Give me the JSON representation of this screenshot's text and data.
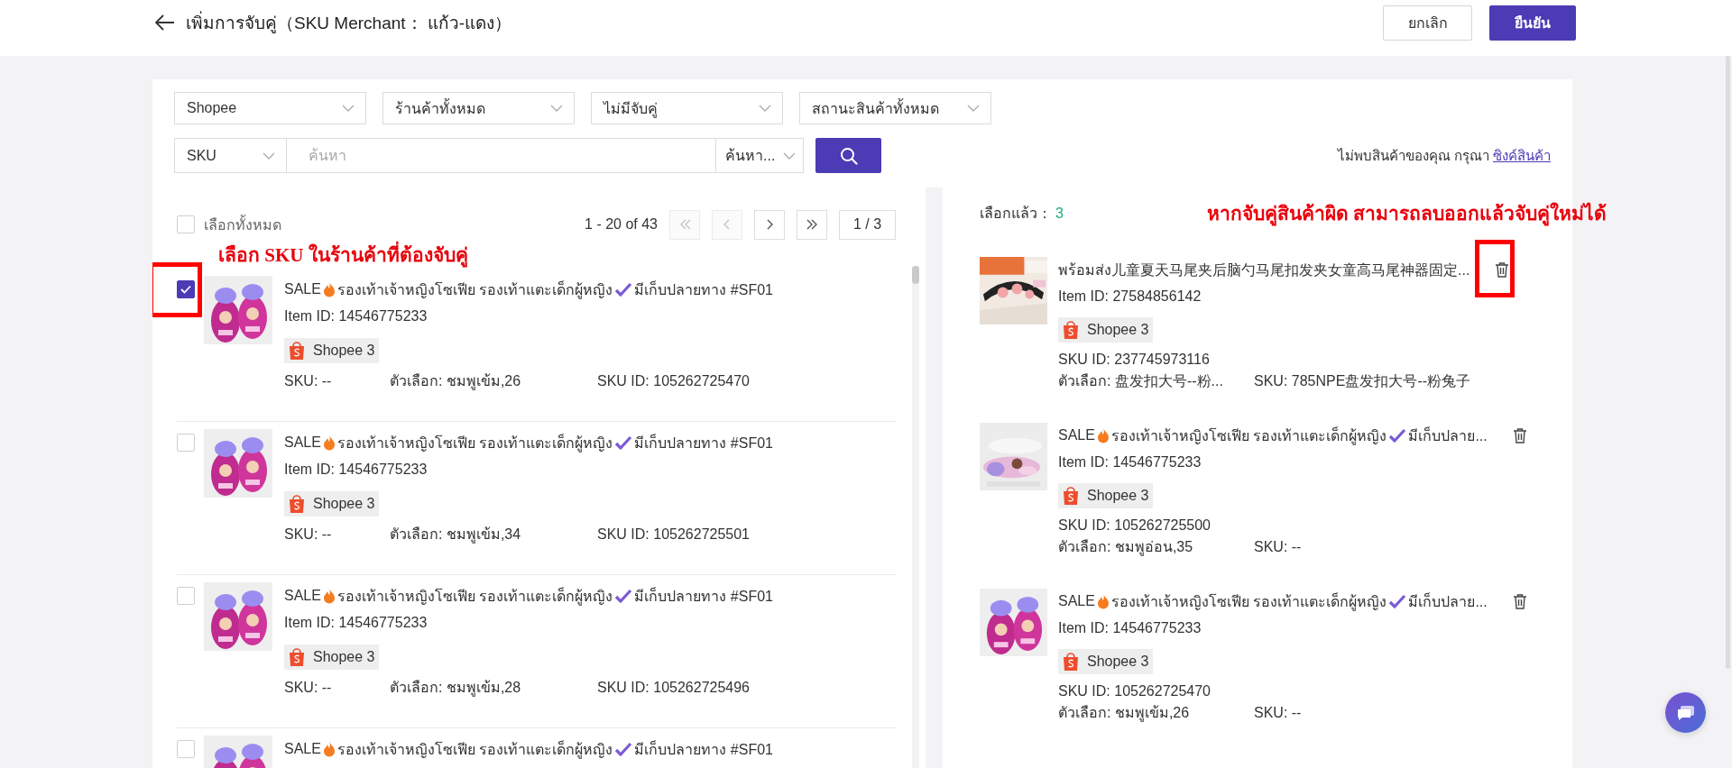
{
  "header": {
    "title": "เพิ่มการจับคู่（SKU Merchant： แก้ว-แดง）",
    "buttons": [
      {
        "label": "ยกเลิก",
        "kind": "secondary"
      },
      {
        "label": "ยืนยัน",
        "kind": "primary"
      }
    ]
  },
  "filters": [
    {
      "value": "Shopee"
    },
    {
      "value": "ร้านค้าทั้งหมด"
    },
    {
      "value": "ไม่มีจับคู่"
    },
    {
      "value": "สถานะสินค้าทั้งหมด"
    }
  ],
  "search": {
    "field_type": "SKU",
    "placeholder": "ค้นหา",
    "mode": "ค้นหา..."
  },
  "sync_hint": {
    "text": "ไม่พบสินค้าของคุณ กรุณา",
    "link": "ซิงค์สินค้า"
  },
  "product_list": {
    "select_all": {
      "label": "เลือกทั้งหมด",
      "checked": false
    },
    "range": "1 - 20 of 43",
    "pager": [
      {
        "kind": "first",
        "disabled": true
      },
      {
        "kind": "prev",
        "disabled": true
      },
      {
        "kind": "next",
        "disabled": false
      },
      {
        "kind": "last",
        "disabled": false
      }
    ],
    "page": "1 / 3",
    "annotation": "เลือก SKU ในร้านค้าที่ต้องจับคู่",
    "items": [
      {
        "checked": true,
        "highlighted": true,
        "thumbnail": {
          "kind": "picture"
        },
        "title_parts": [
          {
            "kind": "text",
            "text": "SALE"
          },
          {
            "kind": "fire"
          },
          {
            "kind": "text",
            "text": "รองเท้าเจ้าหญิงโซเฟีย รองเท้าแตะเด็กผู้หญิง"
          },
          {
            "kind": "check"
          },
          {
            "kind": "text",
            "text": "มีเก็บปลายทาง #SF01"
          }
        ],
        "item_id": "Item ID: 14546775233",
        "shop": "Shopee 3",
        "sku": "SKU: --",
        "option": "ตัวเลือก: ชมพูเข้ม,26",
        "sku_id": "SKU ID: 105262725470"
      },
      {
        "checked": false,
        "highlighted": false,
        "thumbnail": {
          "kind": "picture"
        },
        "title_parts": [
          {
            "kind": "text",
            "text": "SALE"
          },
          {
            "kind": "fire"
          },
          {
            "kind": "text",
            "text": "รองเท้าเจ้าหญิงโซเฟีย รองเท้าแตะเด็กผู้หญิง"
          },
          {
            "kind": "check"
          },
          {
            "kind": "text",
            "text": "มีเก็บปลายทาง #SF01"
          }
        ],
        "item_id": "Item ID: 14546775233",
        "shop": "Shopee 3",
        "sku": "SKU: --",
        "option": "ตัวเลือก: ชมพูเข้ม,34",
        "sku_id": "SKU ID: 105262725501"
      },
      {
        "checked": false,
        "highlighted": false,
        "thumbnail": {
          "kind": "picture"
        },
        "title_parts": [
          {
            "kind": "text",
            "text": "SALE"
          },
          {
            "kind": "fire"
          },
          {
            "kind": "text",
            "text": "รองเท้าเจ้าหญิงโซเฟีย รองเท้าแตะเด็กผู้หญิง"
          },
          {
            "kind": "check"
          },
          {
            "kind": "text",
            "text": "มีเก็บปลายทาง #SF01"
          }
        ],
        "item_id": "Item ID: 14546775233",
        "shop": "Shopee 3",
        "sku": "SKU: --",
        "option": "ตัวเลือก: ชมพูเข้ม,28",
        "sku_id": "SKU ID: 105262725496"
      },
      {
        "checked": false,
        "highlighted": false,
        "thumbnail": {
          "kind": "picture"
        },
        "title_parts": [
          {
            "kind": "text",
            "text": "SALE"
          },
          {
            "kind": "fire"
          },
          {
            "kind": "text",
            "text": "รองเท้าเจ้าหญิงโซเฟีย รองเท้าแตะเด็กผู้หญิง"
          },
          {
            "kind": "check"
          },
          {
            "kind": "text",
            "text": "มีเก็บปลายทาง #SF01"
          }
        ]
      }
    ]
  },
  "selected_panel": {
    "label": "เลือกแล้ว：",
    "count": "3",
    "annotation": "หากจับคู่สินค้าผิด สามารถลบออกแล้วจับคู่ใหม่ได้",
    "items": [
      {
        "highlighted": true,
        "thumbnail": {
          "kind": "picture"
        },
        "title_parts": [
          {
            "kind": "text",
            "text": "พร้อมส่ง儿童夏天马尾夹后脑勺马尾扣发夹女童高马尾神器固定..."
          }
        ],
        "item_id": "Item ID: 27584856142",
        "shop": "Shopee 3",
        "sku_id": "SKU ID: 237745973116",
        "option": "ตัวเลือก: 盘发扣大号--粉...",
        "sku": "SKU: 785NPE盘发扣大号--粉兔子"
      },
      {
        "highlighted": false,
        "thumbnail": {
          "kind": "picture"
        },
        "title_parts": [
          {
            "kind": "text",
            "text": "SALE"
          },
          {
            "kind": "fire"
          },
          {
            "kind": "text",
            "text": "รองเท้าเจ้าหญิงโซเฟีย รองเท้าแตะเด็กผู้หญิง"
          },
          {
            "kind": "check"
          },
          {
            "kind": "text",
            "text": "มีเก็บปลาย..."
          }
        ],
        "item_id": "Item ID: 14546775233",
        "shop": "Shopee 3",
        "sku_id": "SKU ID: 105262725500",
        "option": "ตัวเลือก: ชมพูอ่อน,35",
        "sku": "SKU: --"
      },
      {
        "highlighted": false,
        "thumbnail": {
          "kind": "picture"
        },
        "title_parts": [
          {
            "kind": "text",
            "text": "SALE"
          },
          {
            "kind": "fire"
          },
          {
            "kind": "text",
            "text": "รองเท้าเจ้าหญิงโซเฟีย รองเท้าแตะเด็กผู้หญิง"
          },
          {
            "kind": "check"
          },
          {
            "kind": "text",
            "text": "มีเก็บปลาย..."
          }
        ],
        "item_id": "Item ID: 14546775233",
        "shop": "Shopee 3",
        "sku_id": "SKU ID: 105262725470",
        "option": "ตัวเลือก: ชมพูเข้ม,26",
        "sku": "SKU: --"
      }
    ]
  }
}
